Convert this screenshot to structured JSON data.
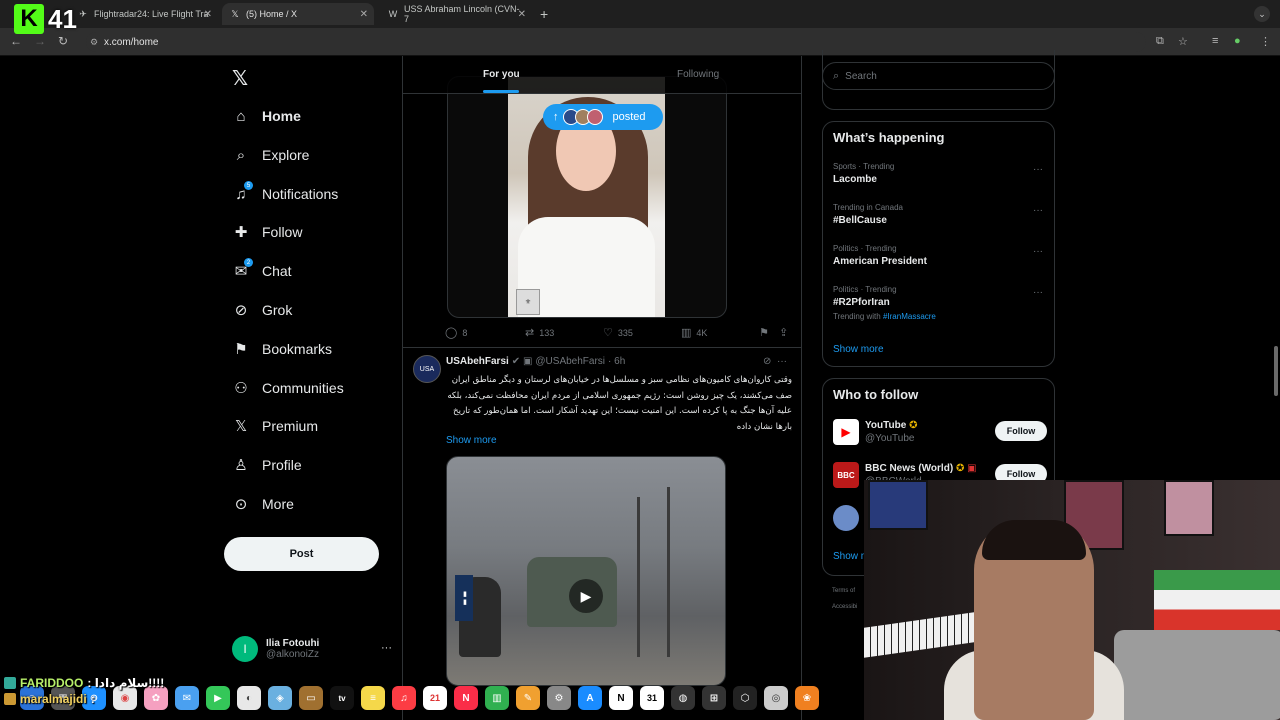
{
  "browser": {
    "tabs": [
      {
        "label": "Flightradar24: Live Flight Tra",
        "active": false
      },
      {
        "label": "(5) Home / X",
        "active": true
      },
      {
        "label": "USS Abraham Lincoln (CVN-7",
        "active": false
      }
    ],
    "new_tab": "+",
    "url": "x.com/home"
  },
  "stream_overlay": {
    "viewer_count": "41",
    "chat": [
      {
        "user": "FARIDDOO",
        "message": ": سلام دادا!!!!"
      },
      {
        "user": "maralmajidi",
        "message": ":"
      }
    ]
  },
  "nav": {
    "items": [
      {
        "label": "Home",
        "icon": "home-icon"
      },
      {
        "label": "Explore",
        "icon": "search-icon"
      },
      {
        "label": "Notifications",
        "icon": "bell-icon",
        "badge": "5"
      },
      {
        "label": "Follow",
        "icon": "person-add-icon"
      },
      {
        "label": "Chat",
        "icon": "mail-icon",
        "badge": "2"
      },
      {
        "label": "Grok",
        "icon": "grok-icon"
      },
      {
        "label": "Bookmarks",
        "icon": "bookmark-icon"
      },
      {
        "label": "Communities",
        "icon": "communities-icon"
      },
      {
        "label": "Premium",
        "icon": "x-premium-icon"
      },
      {
        "label": "Profile",
        "icon": "profile-icon"
      },
      {
        "label": "More",
        "icon": "more-circle-icon"
      }
    ],
    "post_label": "Post",
    "profile": {
      "initial": "I",
      "name": "Ilia Fotouhi",
      "handle": "@alkonoiZz"
    }
  },
  "feed": {
    "tabs": [
      "For you",
      "Following"
    ],
    "posted_pill": "posted",
    "tweet1_actions": {
      "replies": "8",
      "reposts": "133",
      "likes": "335",
      "views": "4K"
    },
    "tweet2": {
      "name": "USAbehFarsi",
      "handle": "@USAbehFarsi",
      "time": "· 6h",
      "text": "وقتی کاروان‌های کامیون‌های نظامی سبز و مسلسل‌ها در خیابان‌های لرستان و دیگر مناطق ایران صف می‌کشند، یک چیز روشن است: رژیم جمهوری اسلامی از مردم ایران محافظت نمی‌کند، بلکه علیه آن‌ها جنگ به پا کرده است. این امنیت نیست؛ این تهدید آشکار است. اما همان‌طور که تاریخ بارها نشان داده",
      "show_more": "Show more"
    }
  },
  "right": {
    "search_placeholder": "Search",
    "whats_happening": {
      "title": "What’s happening",
      "trends": [
        {
          "meta": "Sports · Trending",
          "name": "Lacombe"
        },
        {
          "meta": "Trending in Canada",
          "name": "#BellCause"
        },
        {
          "meta": "Politics · Trending",
          "name": "American President"
        },
        {
          "meta": "Politics · Trending",
          "name": "#R2PforIran",
          "with_label": "Trending with",
          "with_tag": "#IranMassacre"
        }
      ],
      "show_more": "Show more"
    },
    "who_to_follow": {
      "title": "Who to follow",
      "accounts": [
        {
          "name": "YouTube",
          "handle": "@YouTube",
          "follow": "Follow",
          "color": "#ffffff"
        },
        {
          "name": "BBC News (World)",
          "handle": "@BBCWorld",
          "follow": "Follow",
          "color": "#bb1919"
        }
      ],
      "show_more": "Show m"
    },
    "footer": [
      "Terms of",
      "Accessibi"
    ]
  },
  "colors": {
    "accent": "#1d9bf0",
    "background": "#000000",
    "border": "#2f3336",
    "kick_green": "#53fc18"
  }
}
